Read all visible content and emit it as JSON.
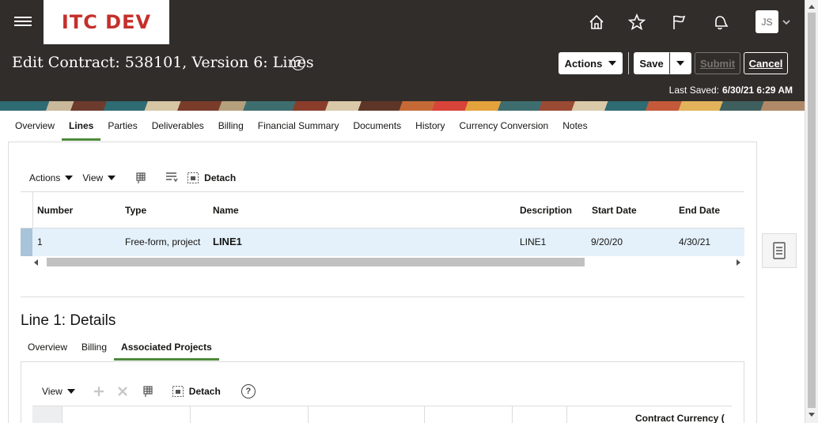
{
  "app": {
    "logo_text": "ITC DEV",
    "avatar_initials": "JS",
    "icons": [
      "menu-icon",
      "home-icon",
      "star-icon",
      "flag-icon",
      "notifications-bell-icon",
      "chevron-down-icon"
    ]
  },
  "header": {
    "title": "Edit Contract: 538101, Version 6: Lines",
    "help_glyph": "?",
    "actions_label": "Actions",
    "save_label": "Save",
    "submit_label": "Submit",
    "cancel_label": "Cancel",
    "last_saved_label": "Last Saved:",
    "last_saved_value": "6/30/21 6:29 AM"
  },
  "main_tabs": [
    {
      "label": "Overview"
    },
    {
      "label": "Lines",
      "active": true
    },
    {
      "label": "Parties"
    },
    {
      "label": "Deliverables"
    },
    {
      "label": "Billing"
    },
    {
      "label": "Financial Summary"
    },
    {
      "label": "Documents"
    },
    {
      "label": "History"
    },
    {
      "label": "Currency Conversion"
    },
    {
      "label": "Notes"
    }
  ],
  "lines_toolbar": {
    "actions_label": "Actions",
    "view_label": "View",
    "detach_label": "Detach"
  },
  "lines_table": {
    "columns": [
      "Number",
      "Type",
      "Name",
      "Description",
      "Start Date",
      "End Date"
    ],
    "rows": [
      {
        "number": "1",
        "type": "Free-form, project",
        "name": "LINE1",
        "description": "LINE1",
        "start_date": "9/20/20",
        "end_date": "4/30/21",
        "selected": true
      }
    ]
  },
  "details": {
    "title": "Line 1: Details",
    "tabs": [
      {
        "label": "Overview"
      },
      {
        "label": "Billing"
      },
      {
        "label": "Associated Projects",
        "active": true
      }
    ],
    "toolbar": {
      "view_label": "View",
      "detach_label": "Detach",
      "help_glyph": "?"
    },
    "table": {
      "visible_header": "Contract Currency ("
    }
  },
  "colors": {
    "header_bg": "#312d2a",
    "logo_text": "#c4302b",
    "tab_active_underline": "#4e8a3a",
    "selected_row_bg": "#e4f1fb"
  }
}
